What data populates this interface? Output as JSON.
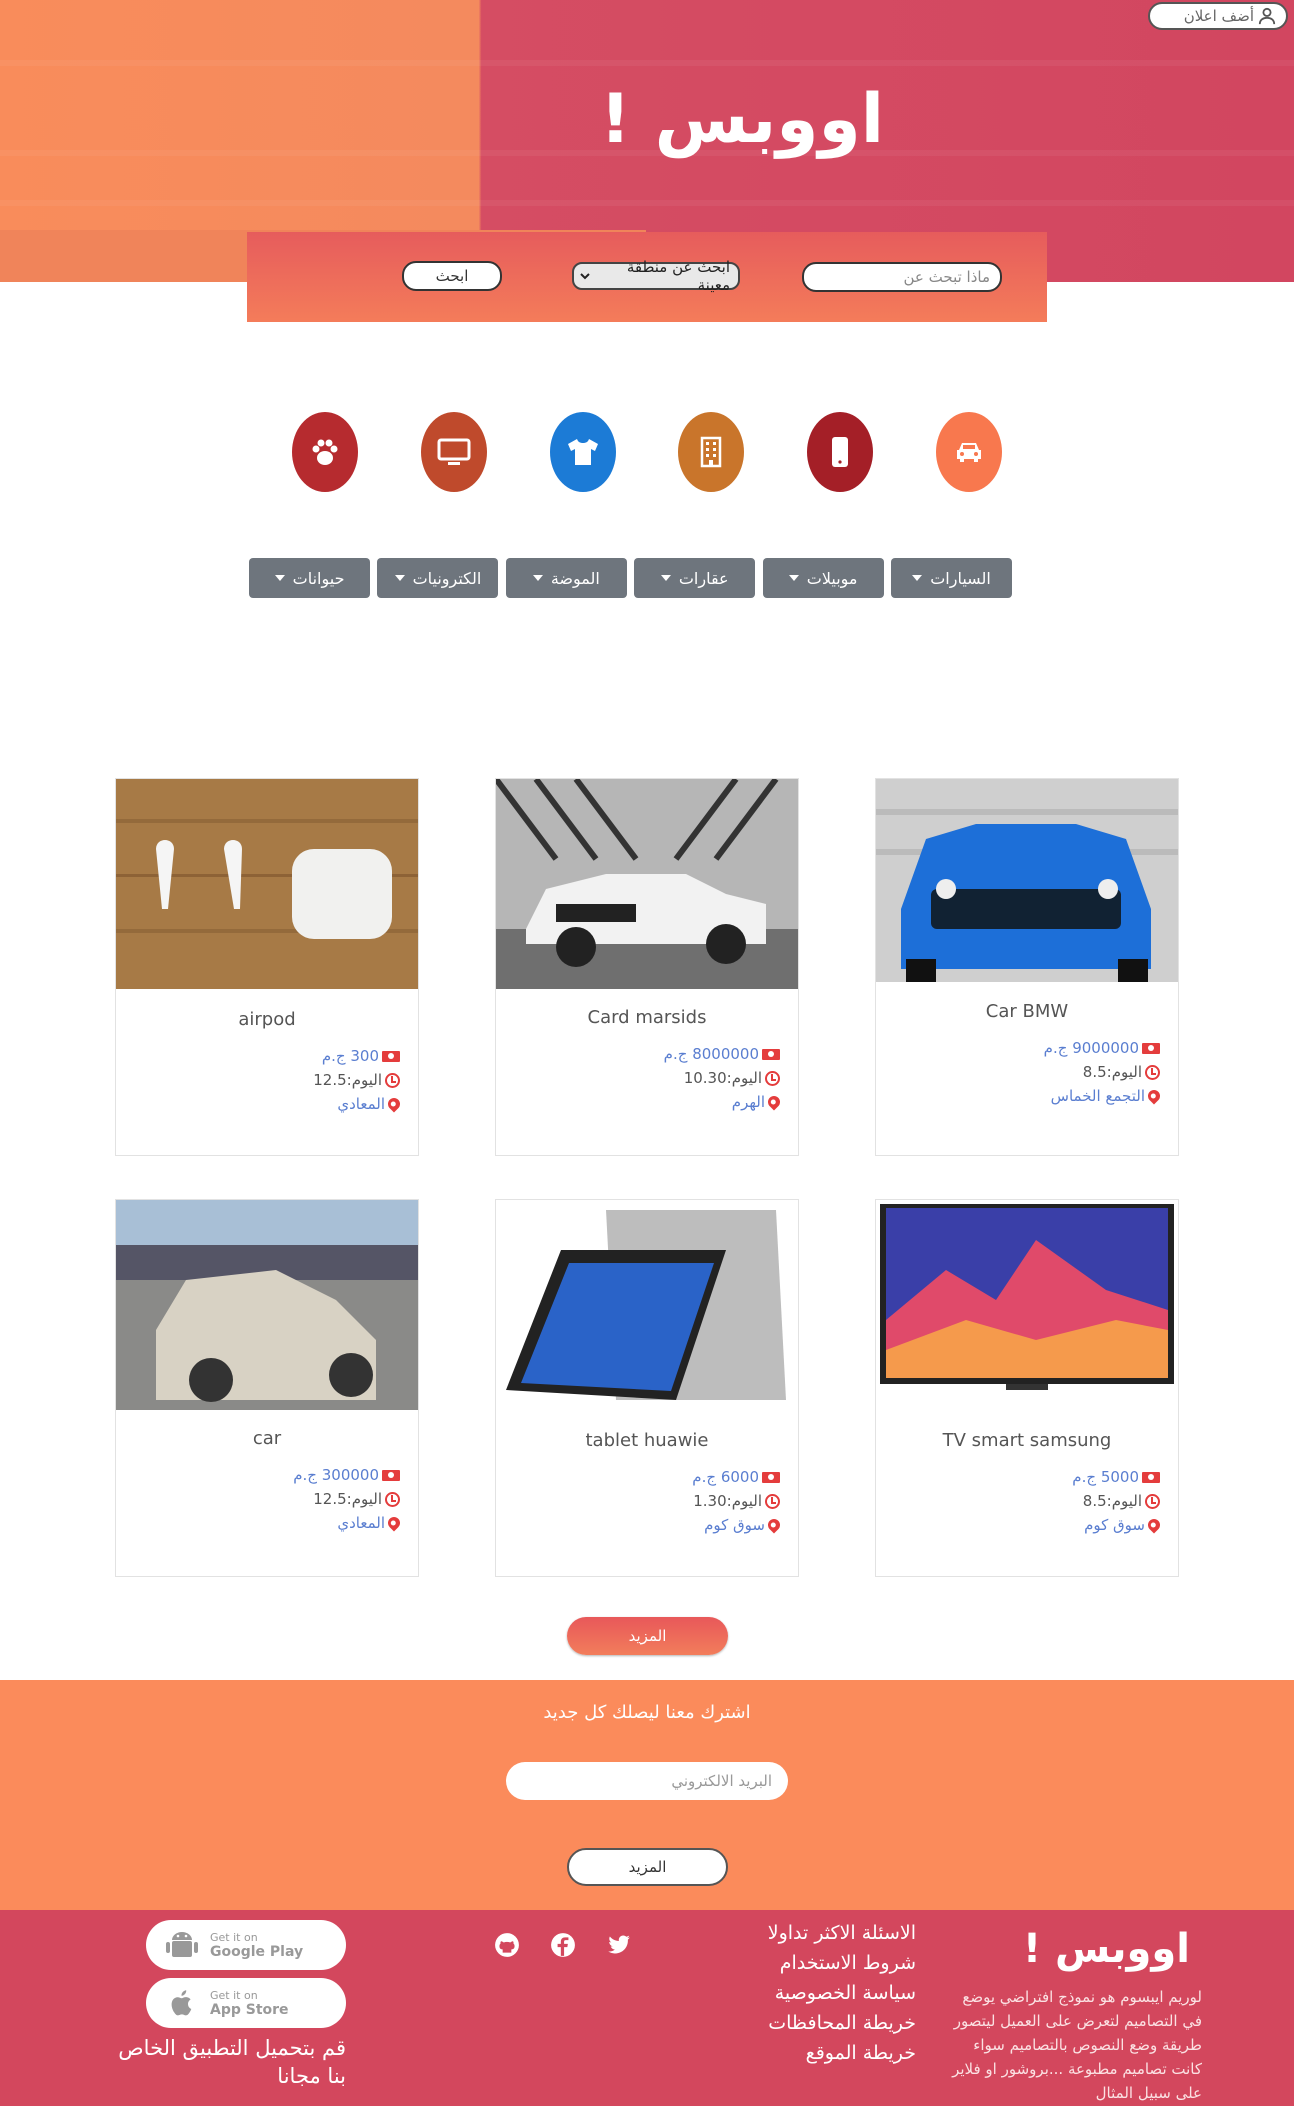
{
  "header": {
    "post_ad_label": "أضف اعلان",
    "brand": "اووبس !"
  },
  "search": {
    "query_placeholder": "ماذا تبحث عن",
    "region_selected": "ابحث عن منطقة معينة",
    "search_label": "ابحث"
  },
  "categories": [
    {
      "label": "السيارات",
      "icon": "car-icon",
      "color": "#f8784e"
    },
    {
      "label": "موبيلات",
      "icon": "mobile-icon",
      "color": "#a41f27"
    },
    {
      "label": "عقارات",
      "icon": "building-icon",
      "color": "#c9752b"
    },
    {
      "label": "الموضة",
      "icon": "tshirt-icon",
      "color": "#1c7bd6"
    },
    {
      "label": "الكترونيات",
      "icon": "monitor-icon",
      "color": "#bf4a2c"
    },
    {
      "label": "حيوانات",
      "icon": "paw-icon",
      "color": "#b62b2f"
    }
  ],
  "products": [
    {
      "title": "airpod",
      "price": "300 ج.م",
      "time": "اليوم:12.5",
      "location": "المعادي"
    },
    {
      "title": "Card marsids",
      "price": "8000000 ج.م",
      "time": "اليوم:10.30",
      "location": "الهرم"
    },
    {
      "title": "Car BMW",
      "price": "9000000 ج.م",
      "time": "اليوم:8.5",
      "location": "التجمع الخماس"
    },
    {
      "title": "car",
      "price": "300000 ج.م",
      "time": "اليوم:12.5",
      "location": "المعادي"
    },
    {
      "title": "tablet huawie",
      "price": "6000 ج.م",
      "time": "اليوم:1.30",
      "location": "سوق كوم"
    },
    {
      "title": "TV smart samsung",
      "price": "5000 ج.م",
      "time": "اليوم:8.5",
      "location": "سوق كوم"
    }
  ],
  "more_label": "المزيد",
  "subscribe": {
    "heading": "اشترك معنا ليصلك كل جديد",
    "email_placeholder": "البريد الالكتروني",
    "button_label": "المزيد"
  },
  "footer": {
    "brand": "اووبس !",
    "description": "لوريم ايبسوم هو نموذج افتراضي يوضع في التصاميم لتعرض على العميل ليتصور طريقة وضع النصوص بالتصاميم سواء كانت تصاميم مطبوعة ...بروشور او فلاير على سبيل المثال",
    "links": [
      "الاسئلة الاكثر تداولا",
      "شروط الاستخدام",
      "سياسة الخصوصية",
      "خريطة المحافظات",
      "خريطة الموقع"
    ],
    "social": [
      "github-icon",
      "facebook-icon",
      "twitter-icon"
    ],
    "google_play": {
      "small": "Get it on",
      "big": "Google Play"
    },
    "app_store": {
      "small": "Get it on",
      "big": "App Store"
    },
    "app_text": "قم بتحميل التطبيق الخاص بنا مجانا"
  }
}
